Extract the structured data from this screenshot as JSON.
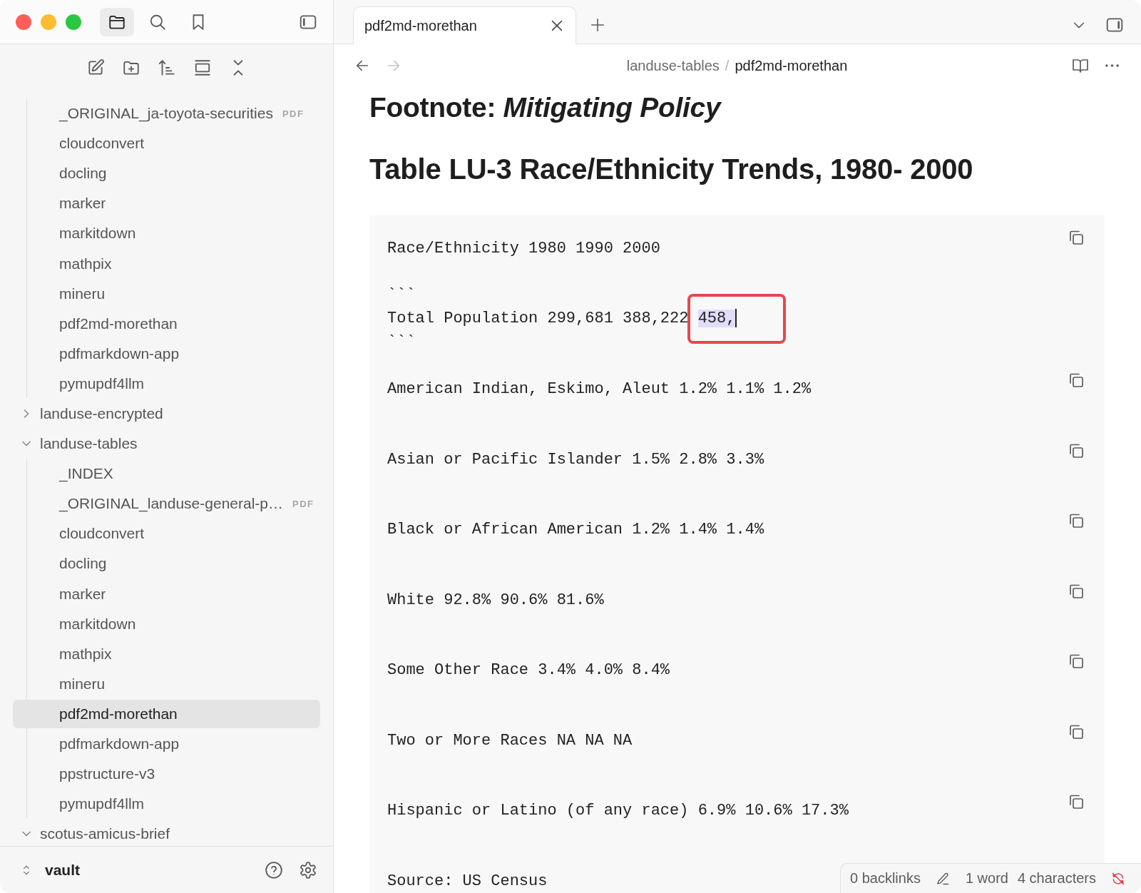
{
  "window": {
    "sidebar_views": [
      {
        "kind": "files",
        "selected": true
      },
      {
        "kind": "search",
        "selected": false
      },
      {
        "kind": "bookmarks",
        "selected": false
      }
    ]
  },
  "sidebar": {
    "tree": [
      {
        "kind": "continuation",
        "children": [
          {
            "label": "_ORIGINAL_ja-toyota-securities",
            "badge": "PDF",
            "selected": false
          },
          {
            "label": "cloudconvert",
            "selected": false
          },
          {
            "label": "docling",
            "selected": false
          },
          {
            "label": "marker",
            "selected": false
          },
          {
            "label": "markitdown",
            "selected": false
          },
          {
            "label": "mathpix",
            "selected": false
          },
          {
            "label": "mineru",
            "selected": false
          },
          {
            "label": "pdf2md-morethan",
            "selected": false
          },
          {
            "label": "pdfmarkdown-app",
            "selected": false
          },
          {
            "label": "pymupdf4llm",
            "selected": false
          }
        ]
      },
      {
        "kind": "folder",
        "label": "landuse-encrypted",
        "expanded": false
      },
      {
        "kind": "folder",
        "label": "landuse-tables",
        "expanded": true,
        "children": [
          {
            "label": "_INDEX",
            "selected": false
          },
          {
            "label": "_ORIGINAL_landuse-general-p…",
            "badge": "PDF",
            "selected": false
          },
          {
            "label": "cloudconvert",
            "selected": false
          },
          {
            "label": "docling",
            "selected": false
          },
          {
            "label": "marker",
            "selected": false
          },
          {
            "label": "markitdown",
            "selected": false
          },
          {
            "label": "mathpix",
            "selected": false
          },
          {
            "label": "mineru",
            "selected": false
          },
          {
            "label": "pdf2md-morethan",
            "selected": true
          },
          {
            "label": "pdfmarkdown-app",
            "selected": false
          },
          {
            "label": "ppstructure-v3",
            "selected": false
          },
          {
            "label": "pymupdf4llm",
            "selected": false
          }
        ]
      },
      {
        "kind": "folder",
        "label": "scotus-amicus-brief",
        "expanded": true
      }
    ],
    "vault": "vault"
  },
  "tabs": [
    {
      "title": "pdf2md-morethan",
      "selected": true
    }
  ],
  "navigation": {
    "back": {
      "disabled": false
    },
    "forward": {
      "disabled": true
    },
    "breadcrumb": {
      "parent": "landuse-tables",
      "separator": "/",
      "current": "pdf2md-morethan"
    }
  },
  "document": {
    "headings": [
      "Footnote: *Mitigating Policy*",
      "Table LU-3 Race/Ethnicity Trends, 1980- 2000"
    ],
    "code_blocks": [
      {
        "lines": [
          {
            "kind": "text",
            "text": "Race/Ethnicity 1980 1990 2000"
          },
          {
            "kind": "fence",
            "text": "```"
          },
          {
            "kind": "text",
            "text": "Total Population 299,681 388,222 ",
            "selection": "458,",
            "cursor": true,
            "annotated": true
          },
          {
            "kind": "fence",
            "text": "```"
          }
        ]
      },
      {
        "lines": [
          {
            "kind": "text",
            "text": "American Indian, Eskimo, Aleut 1.2% 1.1% 1.2%"
          }
        ]
      },
      {
        "lines": [
          {
            "kind": "text",
            "text": "Asian or Pacific Islander 1.5% 2.8% 3.3%"
          }
        ]
      },
      {
        "lines": [
          {
            "kind": "text",
            "text": "Black or African American 1.2% 1.4% 1.4%"
          }
        ]
      },
      {
        "lines": [
          {
            "kind": "text",
            "text": "White 92.8% 90.6% 81.6%"
          }
        ]
      },
      {
        "lines": [
          {
            "kind": "text",
            "text": "Some Other Race 3.4% 4.0% 8.4%"
          }
        ]
      },
      {
        "lines": [
          {
            "kind": "text",
            "text": "Two or More Races NA NA NA"
          }
        ]
      },
      {
        "lines": [
          {
            "kind": "text",
            "text": "Hispanic or Latino (of any race) 6.9% 10.6% 17.3%"
          }
        ]
      },
      {
        "lines": [
          {
            "kind": "text",
            "text": "Source: US Census"
          }
        ]
      }
    ]
  },
  "status_bar": {
    "backlinks": "0 backlinks",
    "words": "1 word",
    "characters": "4 characters"
  }
}
